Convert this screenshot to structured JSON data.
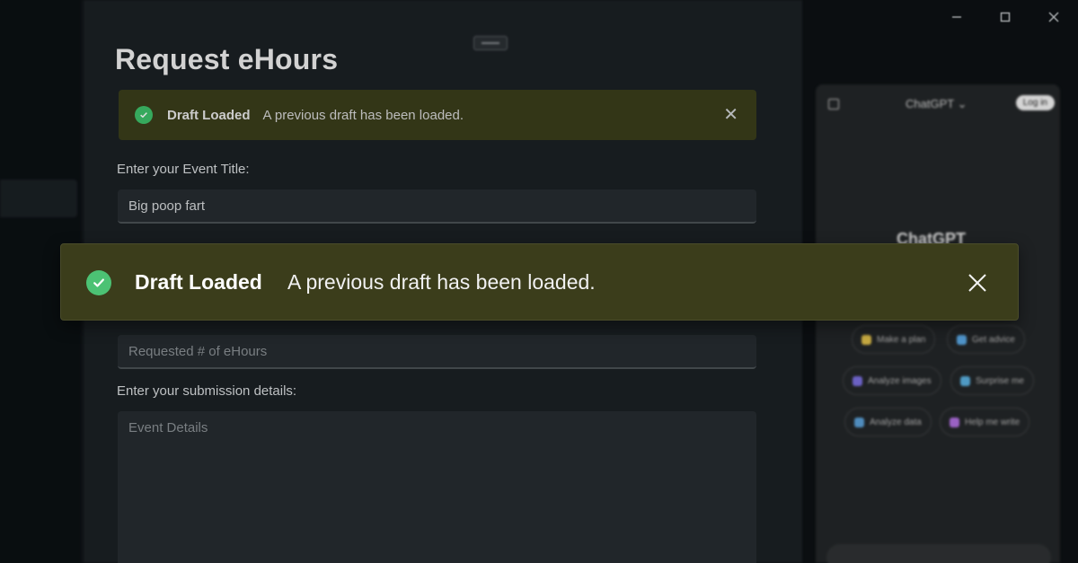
{
  "window": {
    "controls": [
      "minimize-icon",
      "maximize-icon",
      "close-icon"
    ]
  },
  "page": {
    "title": "Request eHours"
  },
  "background_toast": {
    "title": "Draft Loaded",
    "message": "A previous draft has been loaded.",
    "icon": "check-circle-icon",
    "close_icon": "close-icon"
  },
  "form": {
    "event_title_label": "Enter your Event Title:",
    "event_title_value": "Big poop fart",
    "hours_placeholder": "Requested # of eHours",
    "details_label": "Enter your submission details:",
    "details_placeholder": "Event Details"
  },
  "chatgpt_panel": {
    "title": "ChatGPT",
    "login_label": "Log in",
    "heading": "ChatGPT",
    "chips": [
      {
        "label": "Make a plan",
        "color": "#e2c14a"
      },
      {
        "label": "Get advice",
        "color": "#5aa9e6"
      },
      {
        "label": "Analyze images",
        "color": "#7a6fe0"
      },
      {
        "label": "Surprise me",
        "color": "#5ab0e0"
      },
      {
        "label": "Analyze data",
        "color": "#5aa0d8"
      },
      {
        "label": "Help me write",
        "color": "#b06fe0"
      }
    ]
  },
  "toast": {
    "title": "Draft Loaded",
    "message": "A previous draft has been loaded.",
    "icon": "check-circle-icon",
    "close_icon": "close-icon",
    "accent_color": "#4cc274",
    "background_color": "#3b3d1b"
  }
}
